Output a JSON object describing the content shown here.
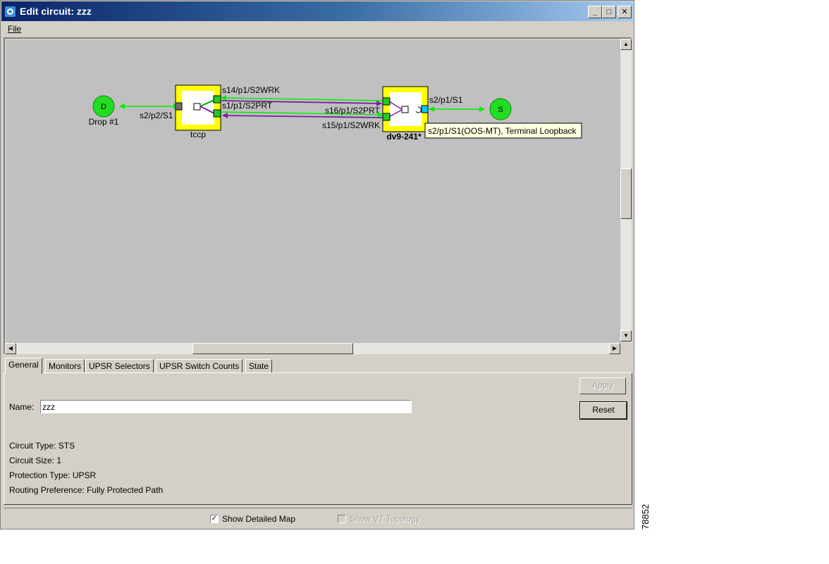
{
  "window": {
    "title": "Edit circuit: zzz",
    "menu_file": "File"
  },
  "map": {
    "drop_node": {
      "letter": "D",
      "label": "Drop #1"
    },
    "source_node": {
      "letter": "S"
    },
    "node_tccp": {
      "name": "tccp"
    },
    "node_dv9": {
      "name": "dv9-241*"
    },
    "ports": {
      "drop_link": "s2/p2/S1",
      "s14": "s14/p1/S2WRK",
      "s1": "s1/p1/S2PRT",
      "s16": "s16/p1/S2PRT",
      "s15": "s15/p1/S2WRK",
      "src_link": "s2/p1/S1"
    },
    "tooltip": "s2/p1/S1(OOS-MT), Terminal Loopback",
    "colors": {
      "node_border": "#ffff00",
      "working": "#00ff00",
      "protect": "#7a1fa2",
      "selected_port": "#00c8ff"
    }
  },
  "tabs": [
    "General",
    "Monitors",
    "UPSR Selectors",
    "UPSR Switch Counts",
    "State"
  ],
  "general": {
    "name_label": "Name:",
    "name_value": "zzz",
    "apply": "Apply",
    "reset": "Reset",
    "circuit_type": "Circuit Type:  STS",
    "circuit_size": "Circuit Size: 1",
    "protection_type": "Protection Type:  UPSR",
    "routing_preference": "Routing Preference: Fully Protected Path"
  },
  "bottom": {
    "show_detailed_map": "Show Detailed Map",
    "show_detailed_map_checked": true,
    "show_vt_topology": "Show VT Topology",
    "show_vt_topology_checked": false
  },
  "figure_id": "78852"
}
